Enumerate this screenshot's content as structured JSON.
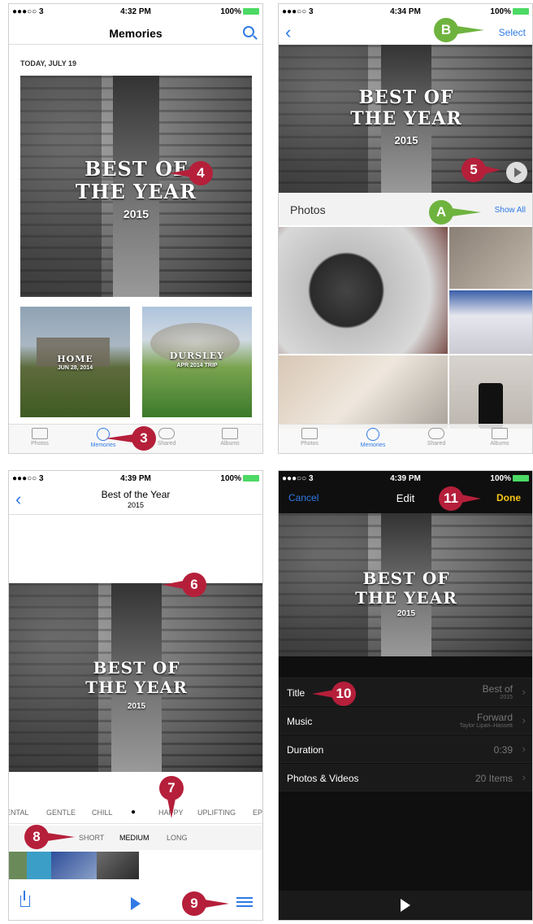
{
  "p1": {
    "status": {
      "carrier": "●●●○○ 3",
      "time": "4:32 PM",
      "battery": "100%"
    },
    "title": "Memories",
    "section_date": "TODAY, JULY 19",
    "feature": {
      "title": "BEST OF THE YEAR",
      "line1": "BEST OF",
      "line2": "THE YEAR",
      "year": "2015"
    },
    "cards": [
      {
        "title": "HOME",
        "subtitle": "JUN 28, 2014"
      },
      {
        "title": "DURSLEY",
        "subtitle": "APR 2014 TRIP"
      }
    ],
    "tabs": [
      "Photos",
      "Memories",
      "Shared",
      "Albums"
    ],
    "callouts": {
      "c3": "3",
      "c4": "4"
    }
  },
  "p2": {
    "status": {
      "carrier": "●●●○○ 3",
      "time": "4:34 PM",
      "battery": "100%"
    },
    "select": "Select",
    "feature": {
      "line1": "BEST OF",
      "line2": "THE YEAR",
      "year": "2015"
    },
    "photos_label": "Photos",
    "show_all": "Show All",
    "tabs": [
      "Photos",
      "Memories",
      "Shared",
      "Albums"
    ],
    "callouts": {
      "cB": "B",
      "c5": "5",
      "cA": "A"
    }
  },
  "p3": {
    "status": {
      "carrier": "●●●○○ 3",
      "time": "4:39 PM",
      "battery": "100%"
    },
    "title": "Best of  the Year",
    "subtitle": "2015",
    "feature": {
      "line1": "BEST OF",
      "line2": "THE YEAR",
      "year": "2015"
    },
    "moods": [
      "ENTAL",
      "GENTLE",
      "CHILL",
      "●",
      "HAPPY",
      "UPLIFTING",
      "EP"
    ],
    "lengths": [
      "SHORT",
      "MEDIUM",
      "LONG"
    ],
    "callouts": {
      "c6": "6",
      "c7": "7",
      "c8": "8",
      "c9": "9"
    }
  },
  "p4": {
    "status": {
      "carrier": "●●●○○ 3",
      "time": "4:39 PM",
      "battery": "100%"
    },
    "cancel": "Cancel",
    "title": "Edit",
    "done": "Done",
    "feature": {
      "line1": "BEST OF",
      "line2": "THE YEAR",
      "year": "2015"
    },
    "rows": [
      {
        "label": "Title",
        "value": "Best of",
        "sub": "2015"
      },
      {
        "label": "Music",
        "value": "Forward",
        "sub": "Taylor Lipari–Hassett"
      },
      {
        "label": "Duration",
        "value": "0:39",
        "sub": ""
      },
      {
        "label": "Photos & Videos",
        "value": "20 Items",
        "sub": ""
      }
    ],
    "callouts": {
      "c10": "10",
      "c11": "11"
    }
  },
  "colors": {
    "accent": "#2f7ae5",
    "callout_red": "#b51f3a",
    "callout_green": "#6fb33f",
    "done_yellow": "#f5c518",
    "battery": "#4cd964"
  }
}
